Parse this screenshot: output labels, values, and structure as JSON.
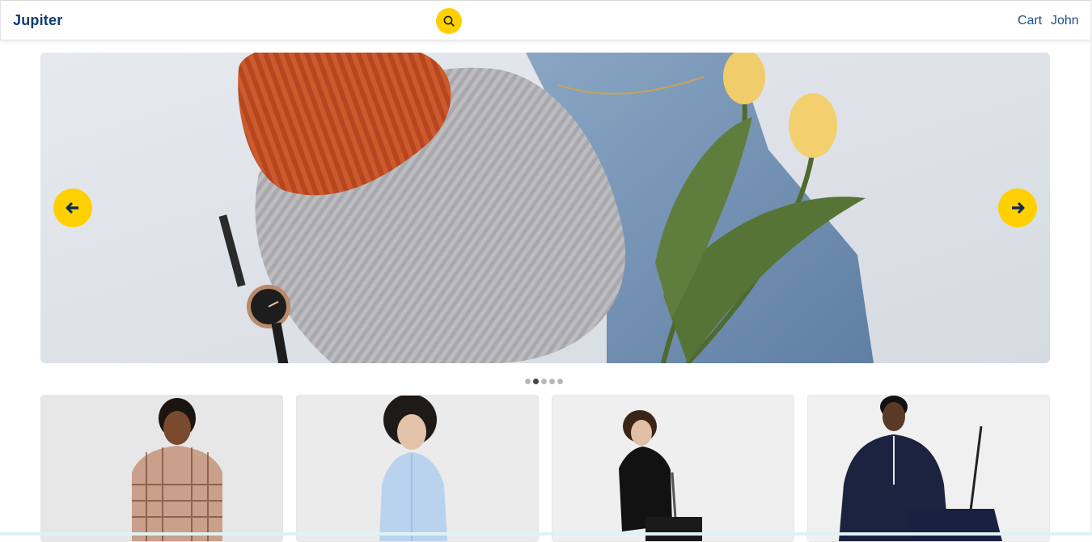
{
  "header": {
    "logo": "Jupiter",
    "search_icon": "search-icon",
    "nav": {
      "cart": "Cart",
      "user": "John"
    }
  },
  "carousel": {
    "prev_icon": "arrow-left-icon",
    "next_icon": "arrow-right-icon",
    "dots_count": 5,
    "active_index": 1
  },
  "colors": {
    "accent": "#ffd000",
    "brand": "#0d3b72",
    "link": "#1f4f8a"
  },
  "products": [
    {
      "name": "plaid-shirt-model"
    },
    {
      "name": "light-blue-shirt-model"
    },
    {
      "name": "black-polo-model"
    },
    {
      "name": "navy-polo-model"
    }
  ]
}
